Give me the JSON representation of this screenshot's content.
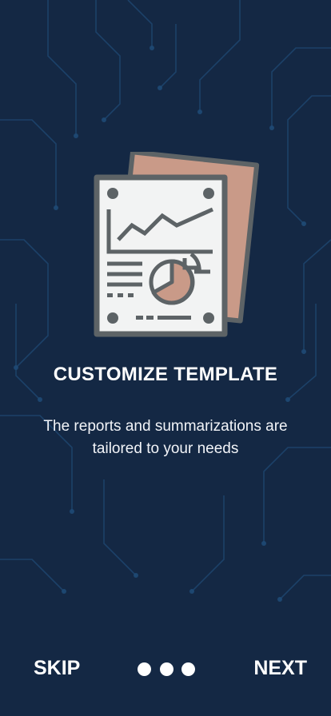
{
  "onboarding": {
    "title": "CUSTOMIZE TEMPLATE",
    "description": "The reports and summarizations are tailored to your needs",
    "illustration_icon": "report-chart-icon"
  },
  "navigation": {
    "skip_label": "SKIP",
    "next_label": "NEXT",
    "page_count": 3
  },
  "colors": {
    "background": "#142844",
    "circuit_lines": "#1f4e7a",
    "report_paper": "#f2f3f3",
    "report_outline": "#5d6366",
    "report_back_sheet": "#c99a88",
    "text": "#ffffff"
  }
}
